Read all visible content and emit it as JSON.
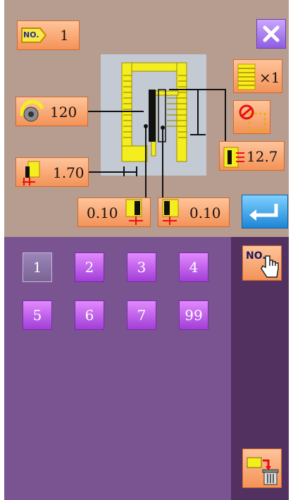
{
  "header": {
    "pattern_no_badge": "NO.",
    "pattern_no": "1"
  },
  "params": {
    "speed": "120",
    "width": "1.70",
    "left_offset": "0.10",
    "right_offset": "0.10",
    "length": "12.7",
    "multiplier": "×1"
  },
  "numbers": [
    "1",
    "2",
    "3",
    "4",
    "5",
    "6",
    "7",
    "99"
  ],
  "selected_number": "1",
  "sidebar": {
    "no_select_badge": "NO."
  },
  "colors": {
    "top_bg": "#b79c90",
    "bottom_bg": "#7a5490",
    "sidebar_bg": "#523060",
    "button_orange": "#f39358",
    "number_purple": "#a13ed6",
    "enter_blue": "#1d86d6",
    "stitch_yellow": "#f5ee1e"
  }
}
